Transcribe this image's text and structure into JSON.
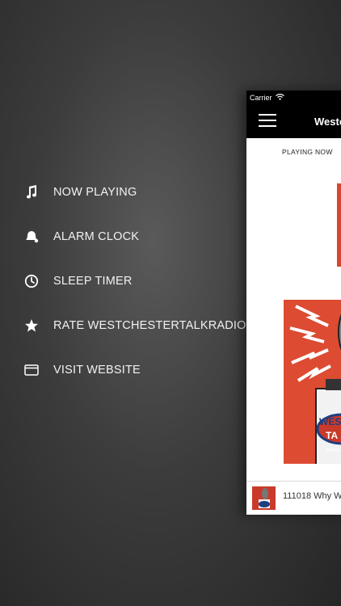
{
  "menu": {
    "items": [
      {
        "label": "NOW PLAYING",
        "icon": "music-note-icon"
      },
      {
        "label": "ALARM CLOCK",
        "icon": "bell-icon"
      },
      {
        "label": "SLEEP TIMER",
        "icon": "clock-icon"
      },
      {
        "label": "RATE WESTCHESTERTALKRADIO",
        "icon": "star-icon"
      },
      {
        "label": "VISIT WEBSITE",
        "icon": "browser-window-icon"
      }
    ]
  },
  "app": {
    "status_bar": {
      "carrier": "Carrier"
    },
    "nav": {
      "title": "Westc"
    },
    "tabs": [
      {
        "label": "PLAYING NOW",
        "active": true
      }
    ],
    "player": {
      "track_title": "111018 Why W"
    },
    "colors": {
      "accent": "#dc4b32",
      "nav_background": "#000000"
    }
  }
}
